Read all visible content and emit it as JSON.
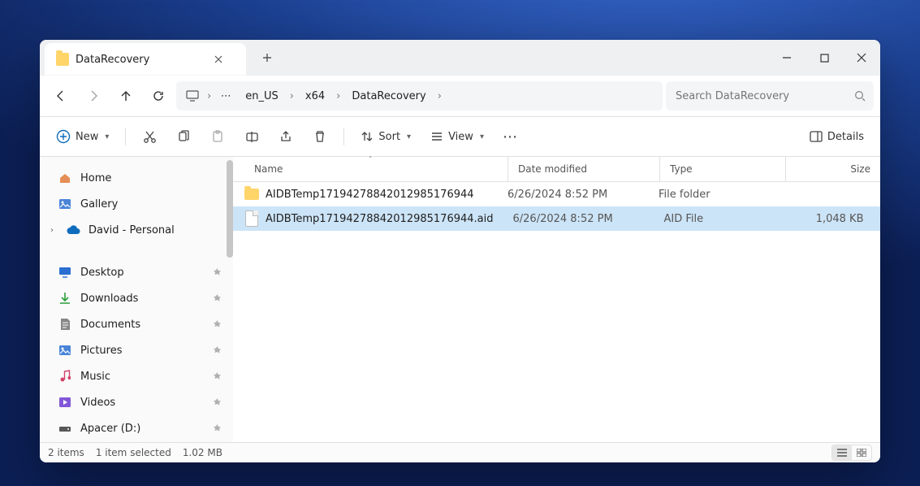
{
  "tab": {
    "title": "DataRecovery"
  },
  "breadcrumbs": [
    "en_US",
    "x64",
    "DataRecovery"
  ],
  "search": {
    "placeholder": "Search DataRecovery"
  },
  "toolbar": {
    "new_label": "New",
    "sort_label": "Sort",
    "view_label": "View",
    "details_label": "Details"
  },
  "sidebar": {
    "home": "Home",
    "gallery": "Gallery",
    "cloud": "David - Personal",
    "quick": [
      {
        "label": "Desktop",
        "icon": "desktop"
      },
      {
        "label": "Downloads",
        "icon": "downloads"
      },
      {
        "label": "Documents",
        "icon": "documents"
      },
      {
        "label": "Pictures",
        "icon": "pictures"
      },
      {
        "label": "Music",
        "icon": "music"
      },
      {
        "label": "Videos",
        "icon": "videos"
      },
      {
        "label": "Apacer (D:)",
        "icon": "drive"
      }
    ]
  },
  "columns": {
    "name": "Name",
    "date": "Date modified",
    "type": "Type",
    "size": "Size"
  },
  "rows": [
    {
      "name": "AIDBTemp17194278842012985176944",
      "date": "6/26/2024 8:52 PM",
      "type": "File folder",
      "size": "",
      "kind": "folder",
      "selected": false
    },
    {
      "name": "AIDBTemp17194278842012985176944.aid",
      "date": "6/26/2024 8:52 PM",
      "type": "AID File",
      "size": "1,048 KB",
      "kind": "file",
      "selected": true
    }
  ],
  "status": {
    "count": "2 items",
    "selection": "1 item selected",
    "size": "1.02 MB"
  }
}
